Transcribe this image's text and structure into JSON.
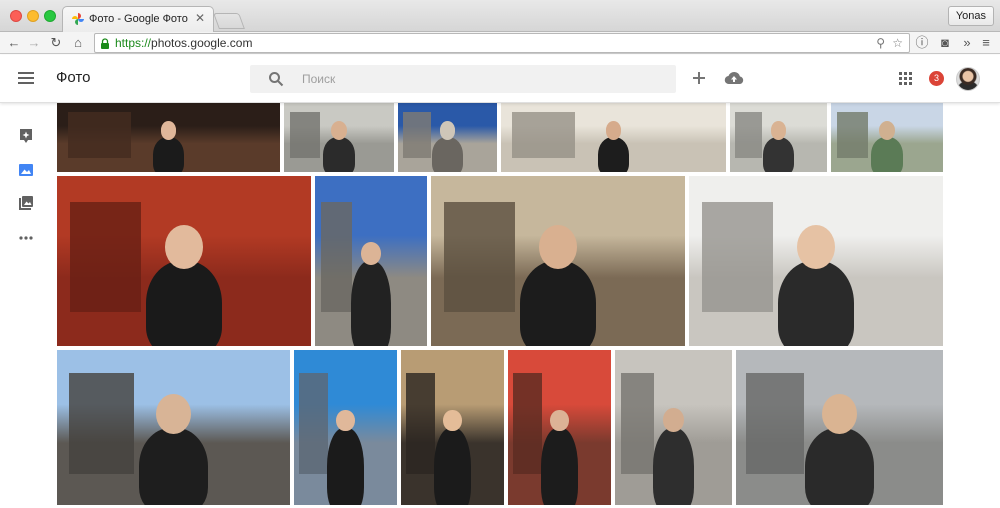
{
  "browser": {
    "tab_title": "Фото - Google Фото",
    "profile_name": "Yonas",
    "url_scheme": "https://",
    "url_rest": "photos.google.com"
  },
  "appbar": {
    "title": "Фото",
    "search_placeholder": "Поиск",
    "notification_count": "3"
  },
  "icons": {
    "menu": "hamburger-menu-icon",
    "search": "search-icon",
    "create": "plus-icon",
    "upload": "cloud-upload-icon",
    "apps": "apps-grid-icon",
    "nav": [
      "assistant-icon",
      "photos-icon",
      "albums-icon",
      "more-icon"
    ]
  },
  "colors": {
    "accent": "#4285f4",
    "badge": "#db4437",
    "search_bg": "#f1f1f1"
  },
  "photos": [
    {
      "id": "r1-1",
      "bg": "#5a3b2a",
      "sky": "#2b1e18",
      "fig": "#1b1b1b",
      "skin": "#e0b79a"
    },
    {
      "id": "r1-2",
      "bg": "#9a9a94",
      "sky": "#c9c9c3",
      "fig": "#2b2b2b",
      "skin": "#d8b090"
    },
    {
      "id": "r1-3",
      "bg": "#a9a49a",
      "sky": "#2a59a8",
      "fig": "#6a6660",
      "skin": "#cfc6b8"
    },
    {
      "id": "r1-4",
      "bg": "#c9c2b5",
      "sky": "#e9e4da",
      "fig": "#1d1d1d",
      "skin": "#d6ab8c"
    },
    {
      "id": "r1-5",
      "bg": "#b7b7b0",
      "sky": "#dcdcd6",
      "fig": "#333",
      "skin": "#d9b393"
    },
    {
      "id": "r1-6",
      "bg": "#9ba68f",
      "sky": "#c9d6e6",
      "fig": "#5b7b56",
      "skin": "#d0b090"
    },
    {
      "id": "r2-1",
      "bg": "#8c2a1c",
      "sky": "#b23a24",
      "fig": "#1a1a1a",
      "skin": "#e2ba9c"
    },
    {
      "id": "r2-2",
      "bg": "#8e8a82",
      "sky": "#3d6fc2",
      "fig": "#222",
      "skin": "#dcb496"
    },
    {
      "id": "r2-3",
      "bg": "#7b6a55",
      "sky": "#c6b79c",
      "fig": "#1c1c1c",
      "skin": "#d9b090"
    },
    {
      "id": "r2-4",
      "bg": "#c9c6c0",
      "sky": "#efefed",
      "fig": "#2a2a2a",
      "skin": "#e6c2a4"
    },
    {
      "id": "r3-1",
      "bg": "#5c5853",
      "sky": "#9cc0e6",
      "fig": "#1e1e1e",
      "skin": "#d8b496"
    },
    {
      "id": "r3-2",
      "bg": "#7a8a9c",
      "sky": "#2f8ad6",
      "fig": "#1b1b1b",
      "skin": "#e0b89a"
    },
    {
      "id": "r3-3",
      "bg": "#3a332c",
      "sky": "#b89c74",
      "fig": "#1b1b1b",
      "skin": "#e4bc98"
    },
    {
      "id": "r3-4",
      "bg": "#7a3a2e",
      "sky": "#d84a3a",
      "fig": "#1c1c1c",
      "skin": "#dcb396"
    },
    {
      "id": "r3-5",
      "bg": "#9f9c96",
      "sky": "#c7c4be",
      "fig": "#2e2e2e",
      "skin": "#d2ad90"
    },
    {
      "id": "r3-6",
      "bg": "#8b8c8a",
      "sky": "#b5b8bb",
      "fig": "#2a2a2a",
      "skin": "#dab492"
    }
  ]
}
